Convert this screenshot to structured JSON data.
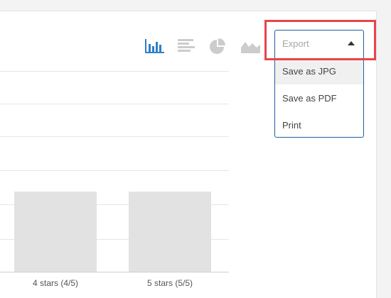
{
  "toolbar": {
    "icons": [
      {
        "name": "bar-chart-icon",
        "active": true
      },
      {
        "name": "horizontal-bar-chart-icon",
        "active": false
      },
      {
        "name": "pie-chart-icon",
        "active": false
      },
      {
        "name": "area-chart-icon",
        "active": false
      }
    ],
    "active_color": "#2f7fc8",
    "inactive_color": "#cccccc"
  },
  "export": {
    "placeholder": "Export",
    "options": [
      "Save as JPG",
      "Save as PDF",
      "Print"
    ],
    "hovered_index": 0,
    "border_color": "#1f5fa0",
    "highlight_color": "#e8454a"
  },
  "chart_data": {
    "type": "bar",
    "categories": [
      "4 stars (4/5)",
      "5 stars (5/5)"
    ],
    "values": [
      1,
      1
    ],
    "ylim": [
      0,
      2.5
    ],
    "grid": true,
    "bar_color": "#e2e2e2"
  }
}
